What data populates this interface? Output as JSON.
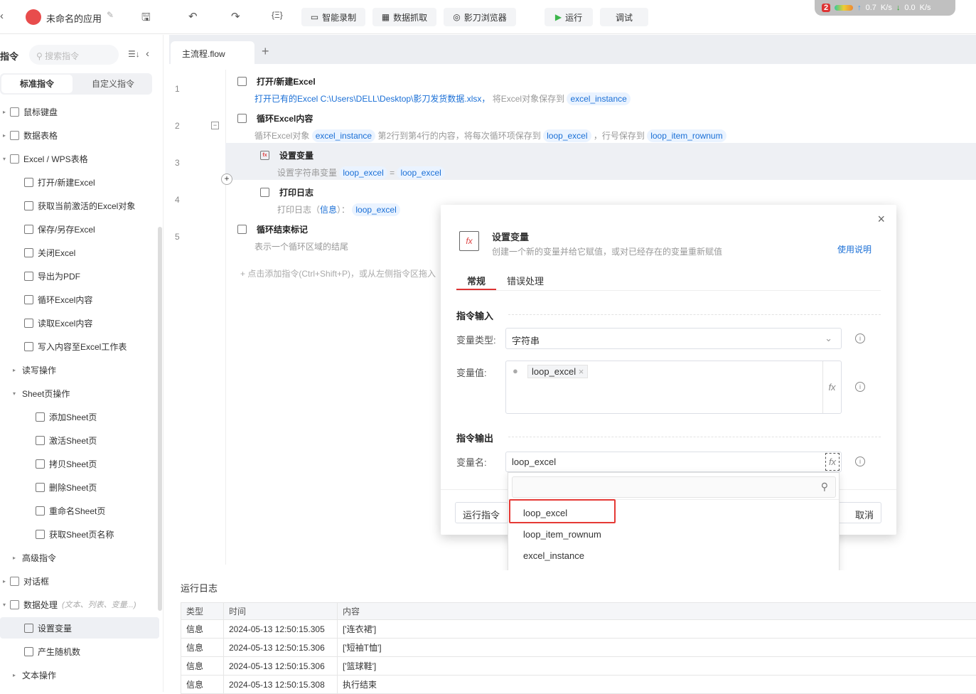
{
  "topbar": {
    "app_title": "未命名的应用",
    "buttons": [
      "智能录制",
      "数据抓取",
      "影刀浏览器"
    ],
    "run": "运行",
    "debug": "调试",
    "net": {
      "badge": "2",
      "up": "0.7",
      "down": "0.0",
      "unit": "K/s"
    }
  },
  "sidebar": {
    "title": "指令",
    "search_placeholder": "搜索指令",
    "tabs": [
      "标准指令",
      "自定义指令"
    ],
    "items": [
      {
        "label": "鼠标键盘",
        "level": 0,
        "arrow": "▸"
      },
      {
        "label": "数据表格",
        "level": 0,
        "arrow": "▸"
      },
      {
        "label": "Excel / WPS表格",
        "level": 0,
        "arrow": "▾"
      },
      {
        "label": "打开/新建Excel",
        "level": 1
      },
      {
        "label": "获取当前激活的Excel对象",
        "level": 1
      },
      {
        "label": "保存/另存Excel",
        "level": 1
      },
      {
        "label": "关闭Excel",
        "level": 1
      },
      {
        "label": "导出为PDF",
        "level": 1
      },
      {
        "label": "循环Excel内容",
        "level": 1
      },
      {
        "label": "读取Excel内容",
        "level": 1
      },
      {
        "label": "写入内容至Excel工作表",
        "level": 1
      },
      {
        "label": "读写操作",
        "level": 1,
        "arrow": "▸"
      },
      {
        "label": "Sheet页操作",
        "level": 1,
        "arrow": "▾"
      },
      {
        "label": "添加Sheet页",
        "level": 2
      },
      {
        "label": "激活Sheet页",
        "level": 2
      },
      {
        "label": "拷贝Sheet页",
        "level": 2
      },
      {
        "label": "删除Sheet页",
        "level": 2
      },
      {
        "label": "重命名Sheet页",
        "level": 2
      },
      {
        "label": "获取Sheet页名称",
        "level": 2
      },
      {
        "label": "高级指令",
        "level": 1,
        "arrow": "▸"
      },
      {
        "label": "对话框",
        "level": 0,
        "arrow": "▸"
      },
      {
        "label": "数据处理",
        "level": 0,
        "arrow": "▾",
        "hint": "(文本、列表、变量...)"
      },
      {
        "label": "设置变量",
        "level": 1,
        "selected": true
      },
      {
        "label": "产生随机数",
        "level": 1
      },
      {
        "label": "文本操作",
        "level": 1,
        "arrow": "▸"
      }
    ]
  },
  "flow": {
    "tab": "主流程.flow",
    "steps": [
      {
        "num": "1",
        "title": "打开/新建Excel",
        "desc": "打开已有的Excel C:\\Users\\DELL\\Desktop\\影刀发货数据.xlsx，",
        "desc2": "将Excel对象保存到",
        "var": "excel_instance"
      },
      {
        "num": "2",
        "title": "循环Excel内容",
        "d1": "循环Excel对象",
        "v1": "excel_instance",
        "d2": "第2行到第4行的内容，将每次循环项保存到",
        "v2": "loop_excel",
        "d3": "，行号保存到",
        "v3": "loop_item_rownum"
      },
      {
        "num": "3",
        "title": "设置变量",
        "d1": "设置字符串变量",
        "v1": "loop_excel",
        "eq": "=",
        "v2": "loop_excel"
      },
      {
        "num": "4",
        "title": "打印日志",
        "d1": "打印日志（",
        "lvl": "信息",
        "d2": "）：",
        "v1": "loop_excel"
      },
      {
        "num": "5",
        "title": "循环结束标记",
        "d1": "表示一个循环区域的结尾"
      }
    ],
    "add_hint": "点击添加指令(Ctrl+Shift+P)，或从左侧指令区拖入"
  },
  "dialog": {
    "title": "设置变量",
    "subtitle": "创建一个新的变量并给它赋值，或对已经存在的变量重新赋值",
    "help": "使用说明",
    "tabs": [
      "常规",
      "错误处理"
    ],
    "input_section": "指令输入",
    "type_label": "变量类型:",
    "type_value": "字符串",
    "value_label": "变量值:",
    "value_chip": "loop_excel",
    "output_section": "指令输出",
    "name_label": "变量名:",
    "name_value": "loop_excel",
    "run_btn": "运行指令",
    "cancel_btn": "取消"
  },
  "dropdown": {
    "options": [
      "loop_excel",
      "loop_item_rownum",
      "excel_instance"
    ]
  },
  "log": {
    "title": "运行日志",
    "headers": [
      "类型",
      "时间",
      "内容"
    ],
    "rows": [
      [
        "信息",
        "2024-05-13 12:50:15.305",
        "['连衣裙']"
      ],
      [
        "信息",
        "2024-05-13 12:50:15.306",
        "['短袖T恤']"
      ],
      [
        "信息",
        "2024-05-13 12:50:15.306",
        "['篮球鞋']"
      ],
      [
        "信息",
        "2024-05-13 12:50:15.308",
        "执行结束"
      ]
    ]
  }
}
